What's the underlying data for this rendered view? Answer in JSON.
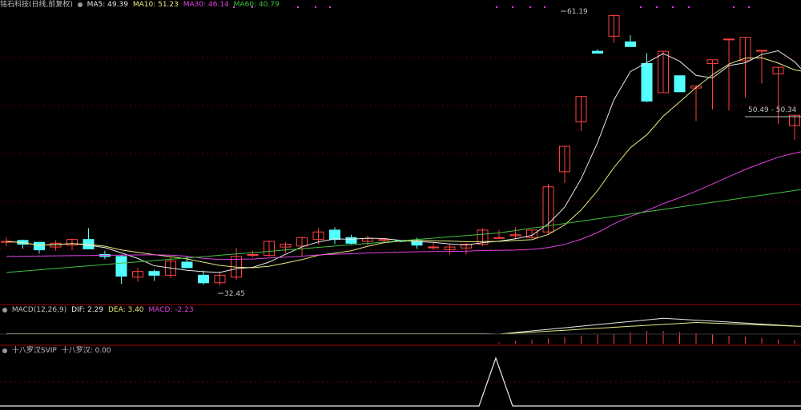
{
  "colors": {
    "up": "#ff4040",
    "down": "#54ffff",
    "ma5": "#e8e8e8",
    "ma10": "#e8e880",
    "ma30": "#e040e0",
    "ma60": "#40c040",
    "divider": "#a00000",
    "grid": "#600000",
    "dif": "#e8e8e8",
    "dea": "#e8e880",
    "macd_bar": "#ff4040",
    "gray_text": "#c0c0c0",
    "signal_dot": "#e040e0"
  },
  "price_panel": {
    "title": "铭石科技(日线,前复权)",
    "ma5_label": "MA5: 49.39",
    "ma10_label": "MA10: 51.23",
    "ma30_label": "MA30: 46.14",
    "ma60_label": "MA60: 40.79",
    "high_marker": "61.19",
    "low_marker": "32.45",
    "tooltip": "50.49 - 50.34"
  },
  "macd_panel": {
    "title": "MACD(12,26,9)",
    "dif_label": "DIF: 2.29",
    "dea_label": "DEA: 3.40",
    "macd_label": "MACD: -2.23"
  },
  "indicator_panel": {
    "title": "十八罗汉SVIP",
    "value_label": "十八罗汉: 0.00"
  },
  "chart_data": {
    "type": "candlestick",
    "candles": [
      [
        37.1,
        37.6,
        36.7,
        37.2
      ],
      [
        37.3,
        37.4,
        36.4,
        36.9
      ],
      [
        37.1,
        37.1,
        35.9,
        36.3
      ],
      [
        36.6,
        37.3,
        36.2,
        37.0
      ],
      [
        36.8,
        37.5,
        36.3,
        37.4
      ],
      [
        37.4,
        38.6,
        36.4,
        36.4
      ],
      [
        35.8,
        36.2,
        35.3,
        35.6
      ],
      [
        35.6,
        35.8,
        32.7,
        33.5
      ],
      [
        33.4,
        34.4,
        32.9,
        34.0
      ],
      [
        34.0,
        34.2,
        33.0,
        33.6
      ],
      [
        33.6,
        35.5,
        33.3,
        35.1
      ],
      [
        35.0,
        35.6,
        34.4,
        34.4
      ],
      [
        33.6,
        34.1,
        32.6,
        32.8
      ],
      [
        32.8,
        34.0,
        32.5,
        33.6
      ],
      [
        33.4,
        36.5,
        33.1,
        35.6
      ],
      [
        35.8,
        36.2,
        35.5,
        35.8
      ],
      [
        35.7,
        37.3,
        35.6,
        37.2
      ],
      [
        36.6,
        37.1,
        36.0,
        36.9
      ],
      [
        36.7,
        37.7,
        35.6,
        37.6
      ],
      [
        37.4,
        38.6,
        36.9,
        38.2
      ],
      [
        38.4,
        38.7,
        36.9,
        37.4
      ],
      [
        37.6,
        37.9,
        36.9,
        37.0
      ],
      [
        37.2,
        37.8,
        36.8,
        37.5
      ],
      [
        37.4,
        37.5,
        37.0,
        37.4
      ],
      [
        37.3,
        37.3,
        37.1,
        37.2
      ],
      [
        37.2,
        37.6,
        36.4,
        36.8
      ],
      [
        36.6,
        37.1,
        36.3,
        36.6
      ],
      [
        36.3,
        36.9,
        35.8,
        36.6
      ],
      [
        36.5,
        37.0,
        35.8,
        36.9
      ],
      [
        36.9,
        38.6,
        36.7,
        38.4
      ],
      [
        37.6,
        38.4,
        37.6,
        37.6
      ],
      [
        37.8,
        38.7,
        37.5,
        37.9
      ],
      [
        37.6,
        38.4,
        37.5,
        38.4
      ],
      [
        38.2,
        43.3,
        38.0,
        43.0
      ],
      [
        44.6,
        46.7,
        43.4,
        47.3
      ],
      [
        49.9,
        52.6,
        48.9,
        52.6
      ],
      [
        57.4,
        57.6,
        57.3,
        57.2
      ],
      [
        59.0,
        60.3,
        58.3,
        61.2
      ],
      [
        58.4,
        59.1,
        58.1,
        57.9
      ],
      [
        56.1,
        57.2,
        52.0,
        52.1
      ],
      [
        53.0,
        53.9,
        53.1,
        57.4
      ],
      [
        54.8,
        54.1,
        53.5,
        53.1
      ],
      [
        53.5,
        52.3,
        50.0,
        53.7
      ],
      [
        56.1,
        51.2,
        51.4,
        56.5
      ],
      [
        58.7,
        52.2,
        51.1,
        58.7
      ],
      [
        56.4,
        56.6,
        52.5,
        58.9
      ],
      [
        57.5,
        54.9,
        54.0,
        57.5
      ],
      [
        55.0,
        50.2,
        49.7,
        55.7
      ],
      [
        49.5,
        48.8,
        48.0,
        50.6
      ],
      [
        48.5,
        48.6,
        47.5,
        49.4
      ]
    ],
    "indicator_value": 0.0
  },
  "labels": {
    "signal_marks": [
      "•",
      "•",
      "•",
      "•",
      "•",
      "•",
      "•",
      "•",
      "•",
      "•",
      "•",
      "•",
      "•"
    ]
  }
}
